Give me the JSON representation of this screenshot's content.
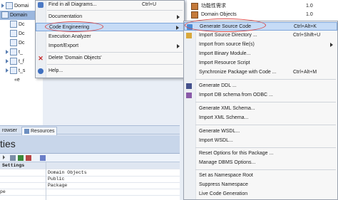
{
  "tree": {
    "items": [
      {
        "label": "Domai",
        "indent": 1
      },
      {
        "label": "Domain",
        "indent": 0,
        "selected": true
      },
      {
        "label": "Dc",
        "indent": 2
      },
      {
        "label": "Dc",
        "indent": 2
      },
      {
        "label": "Dc",
        "indent": 2
      },
      {
        "label": "t_",
        "indent": 1,
        "tri": true
      },
      {
        "label": "t_f",
        "indent": 1,
        "tri": true
      },
      {
        "label": "t_s",
        "indent": 1,
        "tri": true
      },
      {
        "label": "«e",
        "indent": 2
      }
    ]
  },
  "bg_list": [
    {
      "name": "功能性需求",
      "version": "1.0"
    },
    {
      "name": "Domain Objects",
      "version": "1.0"
    }
  ],
  "tabs": [
    {
      "label": "rowser"
    },
    {
      "label": "Resources"
    }
  ],
  "properties": {
    "title": "ties",
    "header": "Settings",
    "rows": [
      {
        "name": "",
        "value": "Domain Objects"
      },
      {
        "name": "",
        "value": "Public"
      },
      {
        "name": "",
        "value": "Package"
      },
      {
        "name": "pe",
        "value": ""
      }
    ]
  },
  "menu": {
    "items": [
      {
        "label": "Find in all Diagrams...",
        "shortcut": "Ctrl+U",
        "icon": "find-icon"
      },
      {
        "separator": true
      },
      {
        "label": "Documentation",
        "submenu": true
      },
      {
        "label": "Code Engineering",
        "submenu": true,
        "highlighted": true
      },
      {
        "label": "Execution Analyzer"
      },
      {
        "label": "Import/Export",
        "submenu": true
      },
      {
        "separator": true
      },
      {
        "label": "Delete 'Domain Objects'",
        "icon": "delete-icon"
      },
      {
        "separator": true
      },
      {
        "label": "Help...",
        "icon": "help-icon"
      }
    ]
  },
  "submenu": {
    "items": [
      {
        "label": "Generate Source Code",
        "shortcut": "Ctrl+Alt+K",
        "icon": "generate-code-icon",
        "highlighted": true
      },
      {
        "label": "Import Source Directory ...",
        "shortcut": "Ctrl+Shift+U",
        "icon": "import-dir-icon"
      },
      {
        "label": "Import from source file(s)",
        "submenu": true
      },
      {
        "label": "Import Binary Module..."
      },
      {
        "label": "Import Resource Script"
      },
      {
        "label": "Synchronize Package with Code ...",
        "shortcut": "Ctrl+Alt+M"
      },
      {
        "separator": true
      },
      {
        "label": "Generate DDL ...",
        "icon": "ddl-icon"
      },
      {
        "label": "Import DB schema from ODBC ...",
        "icon": "db-icon"
      },
      {
        "separator": true
      },
      {
        "label": "Generate XML Schema..."
      },
      {
        "label": "Import XML Schema..."
      },
      {
        "separator": true
      },
      {
        "label": "Generate WSDL..."
      },
      {
        "label": "Import WSDL..."
      },
      {
        "separator": true
      },
      {
        "label": "Reset Options for this Package ..."
      },
      {
        "label": "Manage DBMS Options..."
      },
      {
        "separator": true
      },
      {
        "label": "Set as Namespace Root"
      },
      {
        "label": "Suppress Namespace"
      },
      {
        "label": "Live Code Generation"
      }
    ]
  },
  "colors": {
    "highlight": "#c6dbf6",
    "annotation": "#d94a4a"
  }
}
